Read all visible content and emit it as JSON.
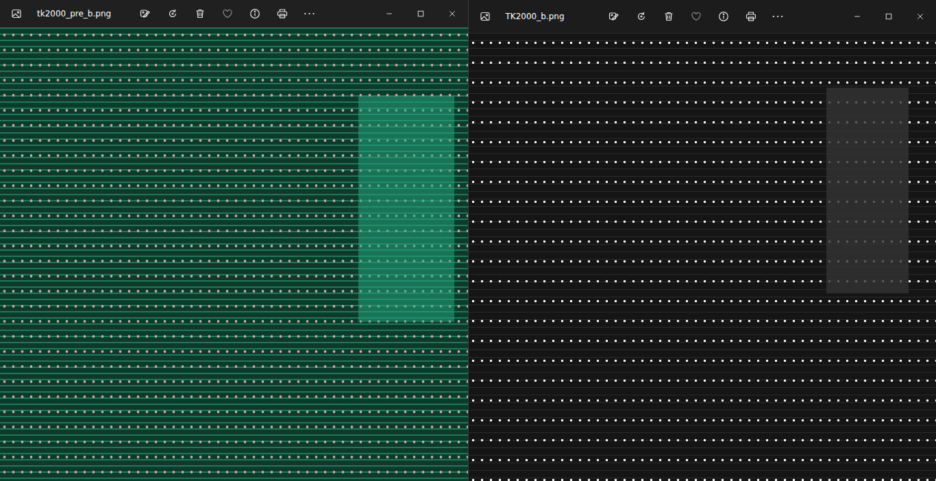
{
  "windows": [
    {
      "title": "tk2000_pre_b.png",
      "more": "···",
      "favorite": false,
      "picture": {
        "kind": "photo"
      }
    },
    {
      "title": "TK2000_b.png",
      "more": "···",
      "favorite": false,
      "picture": {
        "kind": "render"
      }
    }
  ]
}
